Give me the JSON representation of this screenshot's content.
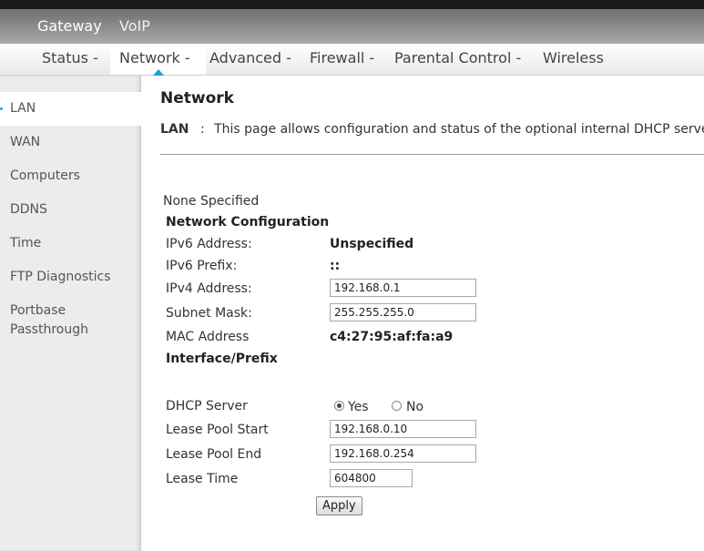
{
  "header": {
    "tabs": [
      "Gateway",
      "VoIP"
    ]
  },
  "nav": {
    "items": [
      {
        "label": "Status -"
      },
      {
        "label": "Network -"
      },
      {
        "label": "Advanced -"
      },
      {
        "label": "Firewall -"
      },
      {
        "label": "Parental Control -"
      },
      {
        "label": "Wireless"
      }
    ],
    "active": "Network -"
  },
  "sidebar": {
    "items": [
      {
        "label": "LAN"
      },
      {
        "label": "WAN"
      },
      {
        "label": "Computers"
      },
      {
        "label": "DDNS"
      },
      {
        "label": "Time"
      },
      {
        "label": "FTP Diagnostics"
      },
      {
        "label": "Portbase"
      },
      {
        "label": "Passthrough"
      }
    ],
    "active": "LAN"
  },
  "page": {
    "title": "Network",
    "desc_key": "LAN",
    "desc_sep": ":",
    "desc_text": "This page allows configuration and status of the optional internal DHCP server"
  },
  "form": {
    "none_specified": "None Specified",
    "section1": "Network Configuration",
    "ipv6_address_label": "IPv6 Address:",
    "ipv6_address_value": "Unspecified",
    "ipv6_prefix_label": "IPv6 Prefix:",
    "ipv6_prefix_value": "::",
    "ipv4_label": "IPv4 Address:",
    "ipv4_value": "192.168.0.1",
    "subnet_label": "Subnet Mask:",
    "subnet_value": "255.255.255.0",
    "mac_label": "MAC Address",
    "mac_value": "c4:27:95:af:fa:a9",
    "section2": "Interface/Prefix",
    "dhcp_label": "DHCP Server",
    "dhcp_yes": "Yes",
    "dhcp_no": "No",
    "dhcp_selected": "Yes",
    "lease_start_label": "Lease Pool Start",
    "lease_start_value": "192.168.0.10",
    "lease_end_label": "Lease Pool End",
    "lease_end_value": "192.168.0.254",
    "lease_time_label": "Lease Time",
    "lease_time_value": "604800",
    "apply_label": "Apply"
  },
  "colors": {
    "accent": "#1e9ed6",
    "header_bg": "#8c8c8c",
    "sidebar_bg": "#ececec"
  }
}
